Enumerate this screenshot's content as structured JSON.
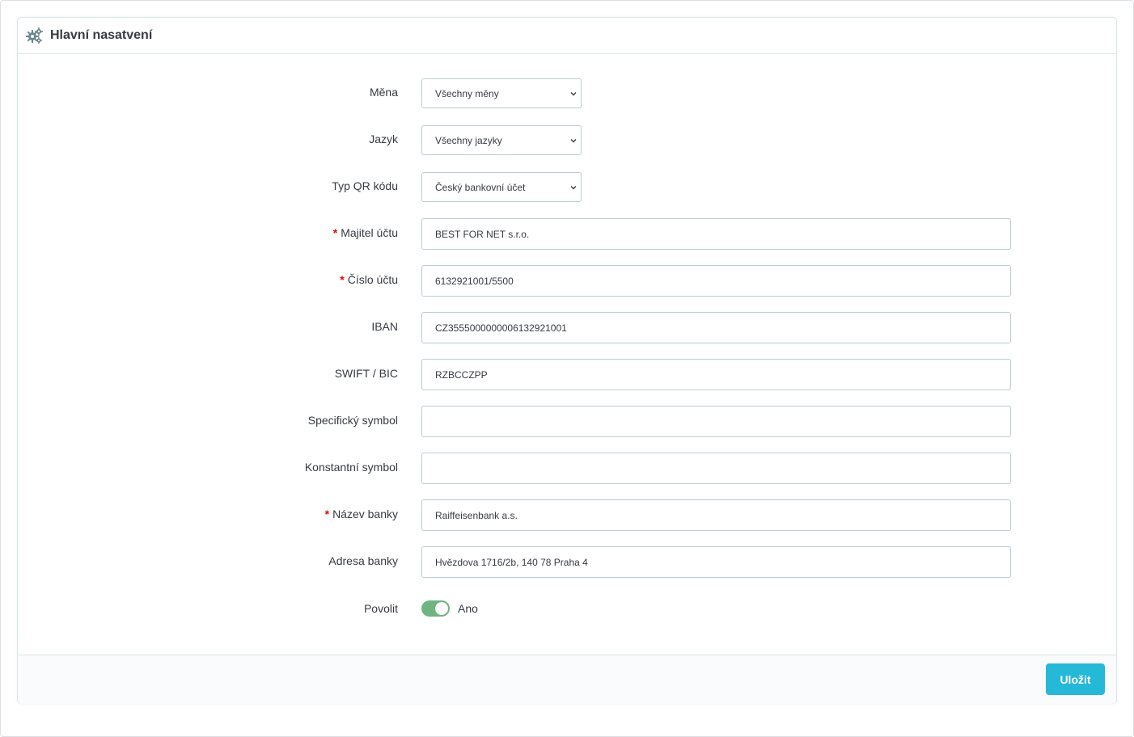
{
  "panel": {
    "title": "Hlavní nasatvení",
    "icon": "cogs-icon"
  },
  "form": {
    "currency": {
      "label": "Měna",
      "value": "Všechny měny"
    },
    "language": {
      "label": "Jazyk",
      "value": "Všechny jazyky"
    },
    "qr_type": {
      "label": "Typ QR kódu",
      "value": "Český bankovní účet"
    },
    "account_owner": {
      "label": "Majitel účtu",
      "required": "*",
      "value": "BEST FOR NET s.r.o."
    },
    "account_number": {
      "label": "Číslo účtu",
      "required": "*",
      "value": "6132921001/5500"
    },
    "iban": {
      "label": "IBAN",
      "value": "CZ3555000000006132921001"
    },
    "swift": {
      "label": "SWIFT / BIC",
      "value": "RZBCCZPP"
    },
    "specific_symbol": {
      "label": "Specifický symbol",
      "value": ""
    },
    "constant_symbol": {
      "label": "Konstantní symbol",
      "value": ""
    },
    "bank_name": {
      "label": "Název banky",
      "required": "*",
      "value": "Raiffeisenbank a.s."
    },
    "bank_address": {
      "label": "Adresa banky",
      "value": "Hvězdova 1716/2b, 140 78 Praha 4"
    },
    "enable": {
      "label": "Povolit",
      "state": "Ano",
      "on": true
    }
  },
  "footer": {
    "save_label": "Uložit"
  },
  "colors": {
    "accent": "#25b9d7",
    "switch_on": "#70b580",
    "required": "#ee0000",
    "border": "#bbcdd2"
  }
}
